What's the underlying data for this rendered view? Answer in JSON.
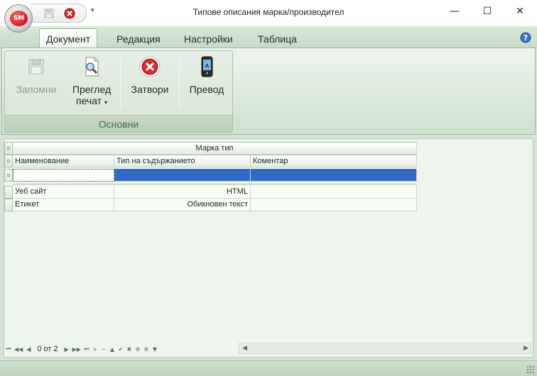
{
  "window": {
    "title": "Типове описания марка/производител",
    "orb_text": "SM",
    "minimize_glyph": "—",
    "maximize_glyph": "☐",
    "close_glyph": "✕",
    "qat_more_glyph": "▾"
  },
  "tabs": [
    {
      "label": "Документ",
      "active": true
    },
    {
      "label": "Редакция",
      "active": false
    },
    {
      "label": "Настройки",
      "active": false
    },
    {
      "label": "Таблица",
      "active": false
    }
  ],
  "ribbon": {
    "group_label": "Основни",
    "buttons": [
      {
        "label": "Запомни",
        "icon": "save-icon",
        "enabled": false
      },
      {
        "label": "Преглед",
        "label2": "печат",
        "dropdown_glyph": "▾",
        "icon": "print-preview-icon",
        "enabled": true
      },
      {
        "label": "Затвори",
        "icon": "close-red-icon",
        "enabled": true
      },
      {
        "label": "Превод",
        "icon": "translate-device-icon",
        "enabled": true
      }
    ]
  },
  "grid": {
    "band_title": "Марка тип",
    "columns": [
      "Наименование",
      "Тип на съдържанието",
      "Коментар"
    ],
    "rows": [
      {
        "name": "Уеб сайт",
        "type": "HTML",
        "comment": ""
      },
      {
        "name": "Етикет",
        "type": "Обикновен текст",
        "comment": ""
      }
    ],
    "indicator_glyph": "✲"
  },
  "navigator": {
    "position_text": "0 от 2",
    "buttons": [
      "⏮",
      "◀◀",
      "◀",
      "▶",
      "▶▶",
      "⏭",
      "+",
      "−",
      "▲",
      "✔",
      "✖",
      "✲",
      "✲",
      "▼"
    ]
  },
  "colors": {
    "accent": "#316ac5",
    "theme_green": "#d4e3d4",
    "close_red": "#d21a1a"
  }
}
